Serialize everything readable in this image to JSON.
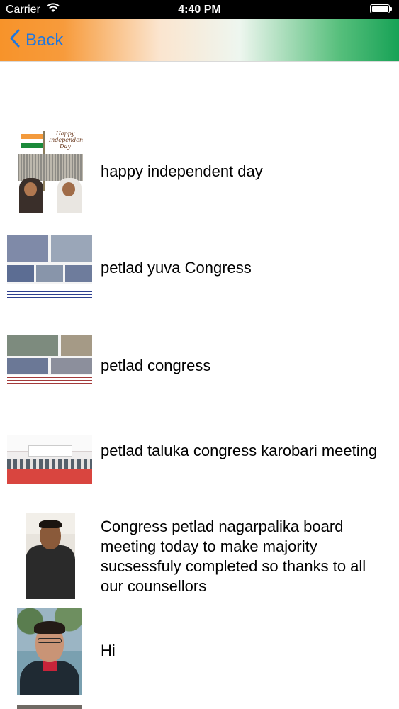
{
  "status_bar": {
    "carrier": "Carrier",
    "time": "4:40 PM"
  },
  "nav": {
    "back_label": "Back",
    "gradient_colors": [
      "#f7932a",
      "#ffffff",
      "#17a256"
    ]
  },
  "posts": [
    {
      "title": "happy independent day",
      "thumbnail": "independence-day-poster",
      "thumb_text": "Happy Independence Day"
    },
    {
      "title": "petlad yuva Congress",
      "thumbnail": "event-photo-collage"
    },
    {
      "title": "petlad congress",
      "thumbnail": "event-photo-collage"
    },
    {
      "title": "petlad taluka congress karobari meeting",
      "thumbnail": "meeting-hall-photo"
    },
    {
      "title": "Congress petlad nagarpalika board meeting today to make majority sucsessfuly completed  so thanks to all our counsellors",
      "thumbnail": "portrait-photo"
    },
    {
      "title": "Hi",
      "thumbnail": "selfie-photo"
    }
  ],
  "colors": {
    "link": "#1f77e0",
    "text": "#000000",
    "background": "#ffffff"
  }
}
